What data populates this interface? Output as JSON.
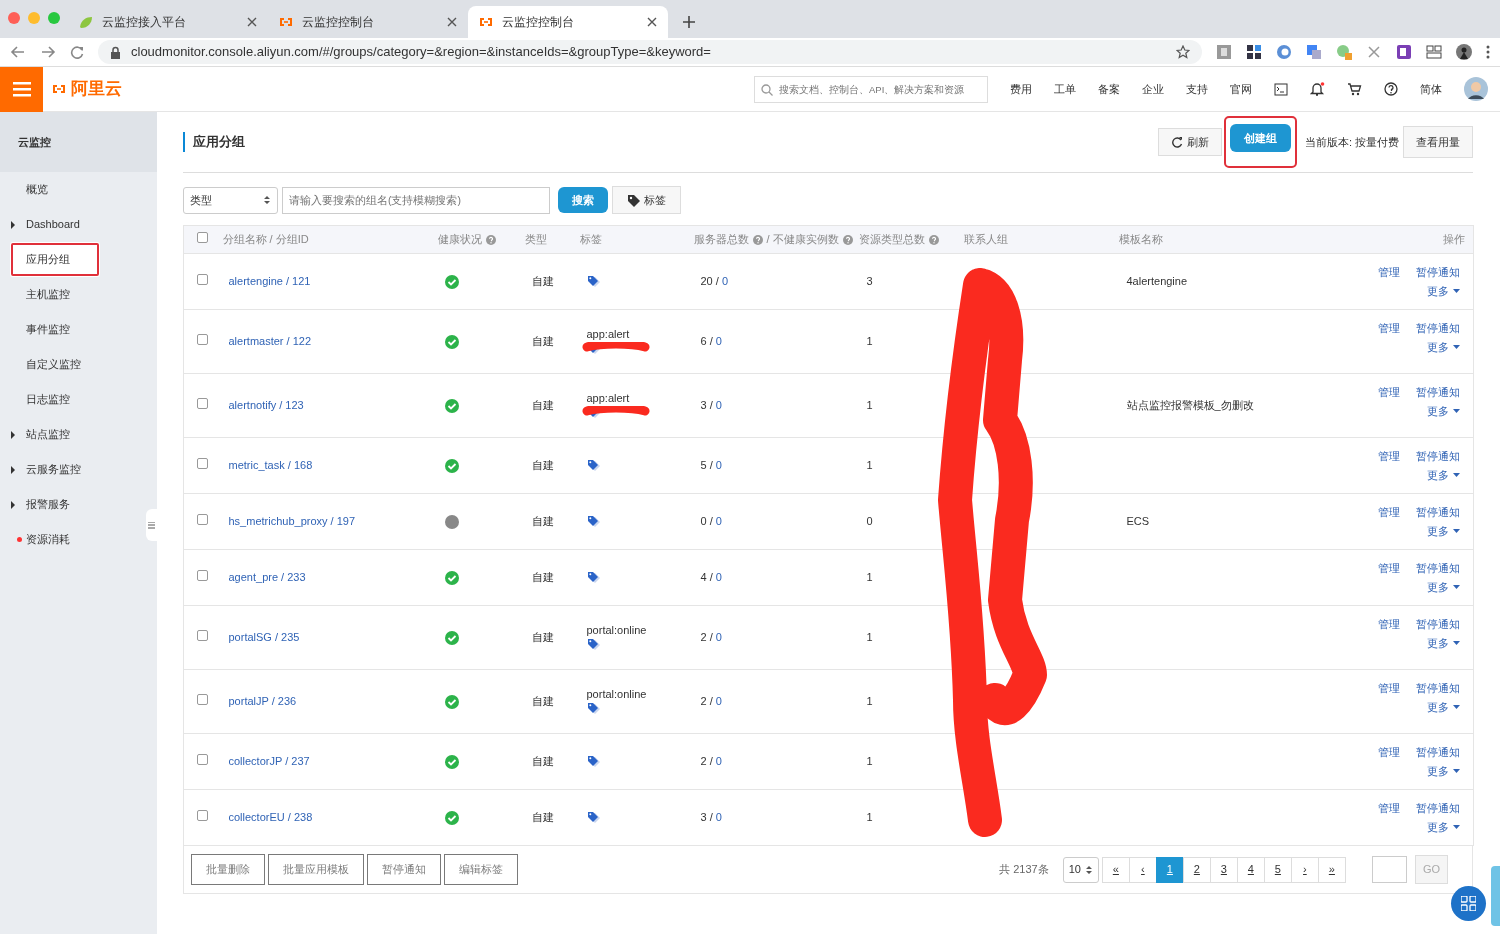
{
  "browser": {
    "tabs": [
      {
        "title": "云监控接入平台",
        "selected": false
      },
      {
        "title": "云监控控制台",
        "selected": false
      },
      {
        "title": "云监控控制台",
        "selected": true
      }
    ],
    "url": "cloudmonitor.console.aliyun.com/#/groups/category=&region=&instanceIds=&groupType=&keyword="
  },
  "header": {
    "logo": "阿里云",
    "search_placeholder": "搜索文档、控制台、API、解决方案和资源",
    "nav": [
      "费用",
      "工单",
      "备案",
      "企业",
      "支持",
      "官网"
    ],
    "language": "简体"
  },
  "sidebar": {
    "title": "云监控",
    "items": [
      {
        "label": "概览",
        "expandable": false,
        "selected": false,
        "highlighted": false,
        "alert": false
      },
      {
        "label": "Dashboard",
        "expandable": true,
        "selected": false,
        "highlighted": false,
        "alert": false
      },
      {
        "label": "应用分组",
        "expandable": false,
        "selected": true,
        "highlighted": true,
        "alert": false
      },
      {
        "label": "主机监控",
        "expandable": false,
        "selected": false,
        "highlighted": false,
        "alert": false
      },
      {
        "label": "事件监控",
        "expandable": false,
        "selected": false,
        "highlighted": false,
        "alert": false
      },
      {
        "label": "自定义监控",
        "expandable": false,
        "selected": false,
        "highlighted": false,
        "alert": false
      },
      {
        "label": "日志监控",
        "expandable": false,
        "selected": false,
        "highlighted": false,
        "alert": false
      },
      {
        "label": "站点监控",
        "expandable": true,
        "selected": false,
        "highlighted": false,
        "alert": false
      },
      {
        "label": "云服务监控",
        "expandable": true,
        "selected": false,
        "highlighted": false,
        "alert": false
      },
      {
        "label": "报警服务",
        "expandable": true,
        "selected": false,
        "highlighted": false,
        "alert": false
      },
      {
        "label": "资源消耗",
        "expandable": false,
        "selected": false,
        "highlighted": false,
        "alert": true
      }
    ]
  },
  "page": {
    "title": "应用分组",
    "refresh": "刷新",
    "create": "创建组",
    "create_highlighted": true,
    "version_label": "当前版本:",
    "version": "按量付费",
    "usage": "查看用量"
  },
  "filter": {
    "type_select": "类型",
    "search_placeholder": "请输入要搜索的组名(支持模糊搜索)",
    "search_button": "搜索",
    "tag_button": "标签"
  },
  "table": {
    "all_checked": false,
    "columns": [
      {
        "label": "分组名称 / 分组ID",
        "help": false
      },
      {
        "label": "健康状况",
        "help": true
      },
      {
        "label": "类型",
        "help": false
      },
      {
        "label": "标签",
        "help": false
      },
      {
        "label": "服务器总数",
        "help": true,
        "label2": "/ 不健康实例数",
        "help2": true
      },
      {
        "label": "资源类型总数",
        "help": true
      },
      {
        "label": "联系人组",
        "help": false
      },
      {
        "label": "模板名称",
        "help": false
      },
      {
        "label": "操作",
        "help": false
      }
    ],
    "rows": [
      {
        "checked": false,
        "name": "alertengine / 121",
        "healthy": true,
        "type": "自建",
        "tag": "",
        "scribbled": false,
        "servers": "20 /",
        "unhealthy": "0",
        "resources": "3",
        "template": "4alertengine",
        "actions": [
          "管理",
          "暂停通知"
        ],
        "more": "更多"
      },
      {
        "checked": false,
        "name": "alertmaster / 122",
        "healthy": true,
        "type": "自建",
        "tag": "app:alert",
        "scribbled": true,
        "servers": "6 /",
        "unhealthy": "0",
        "resources": "1",
        "template": "",
        "actions": [
          "管理",
          "暂停通知"
        ],
        "more": "更多"
      },
      {
        "checked": false,
        "name": "alertnotify / 123",
        "healthy": true,
        "type": "自建",
        "tag": "app:alert",
        "scribbled": true,
        "servers": "3 /",
        "unhealthy": "0",
        "resources": "1",
        "template": "站点监控报警模板_勿删改",
        "actions": [
          "管理",
          "暂停通知"
        ],
        "more": "更多"
      },
      {
        "checked": false,
        "name": "metric_task / 168",
        "healthy": true,
        "type": "自建",
        "tag": "",
        "scribbled": false,
        "servers": "5 /",
        "unhealthy": "0",
        "resources": "1",
        "template": "",
        "actions": [
          "管理",
          "暂停通知"
        ],
        "more": "更多"
      },
      {
        "checked": false,
        "name": "hs_metrichub_proxy / 197",
        "healthy": false,
        "type": "自建",
        "tag": "",
        "scribbled": false,
        "servers": "0 /",
        "unhealthy": "0",
        "resources": "0",
        "template": "ECS",
        "actions": [
          "管理",
          "暂停通知"
        ],
        "more": "更多"
      },
      {
        "checked": false,
        "name": "agent_pre / 233",
        "healthy": true,
        "type": "自建",
        "tag": "",
        "scribbled": false,
        "servers": "4 /",
        "unhealthy": "0",
        "resources": "1",
        "template": "",
        "actions": [
          "管理",
          "暂停通知"
        ],
        "more": "更多"
      },
      {
        "checked": false,
        "name": "portalSG / 235",
        "healthy": true,
        "type": "自建",
        "tag": "portal:online",
        "scribbled": false,
        "servers": "2 /",
        "unhealthy": "0",
        "resources": "1",
        "template": "",
        "actions": [
          "管理",
          "暂停通知"
        ],
        "more": "更多"
      },
      {
        "checked": false,
        "name": "portalJP / 236",
        "healthy": true,
        "type": "自建",
        "tag": "portal:online",
        "scribbled": false,
        "servers": "2 /",
        "unhealthy": "0",
        "resources": "1",
        "template": "",
        "actions": [
          "管理",
          "暂停通知"
        ],
        "more": "更多"
      },
      {
        "checked": false,
        "name": "collectorJP / 237",
        "healthy": true,
        "type": "自建",
        "tag": "",
        "scribbled": false,
        "servers": "2 /",
        "unhealthy": "0",
        "resources": "1",
        "template": "",
        "actions": [
          "管理",
          "暂停通知"
        ],
        "more": "更多"
      },
      {
        "checked": false,
        "name": "collectorEU / 238",
        "healthy": true,
        "type": "自建",
        "tag": "",
        "scribbled": false,
        "servers": "3 /",
        "unhealthy": "0",
        "resources": "1",
        "template": "",
        "actions": [
          "管理",
          "暂停通知"
        ],
        "more": "更多"
      }
    ]
  },
  "footer": {
    "batch": [
      "批量删除",
      "批量应用模板",
      "暂停通知",
      "编辑标签"
    ],
    "total": "共 2137条",
    "page_size": "10",
    "pages": [
      {
        "label": "«",
        "selected": false
      },
      {
        "label": "‹",
        "selected": false
      },
      {
        "label": "1",
        "selected": true
      },
      {
        "label": "2",
        "selected": false
      },
      {
        "label": "3",
        "selected": false
      },
      {
        "label": "4",
        "selected": false
      },
      {
        "label": "5",
        "selected": false
      },
      {
        "label": "›",
        "selected": false
      },
      {
        "label": "»",
        "selected": false
      }
    ],
    "go": "GO"
  }
}
